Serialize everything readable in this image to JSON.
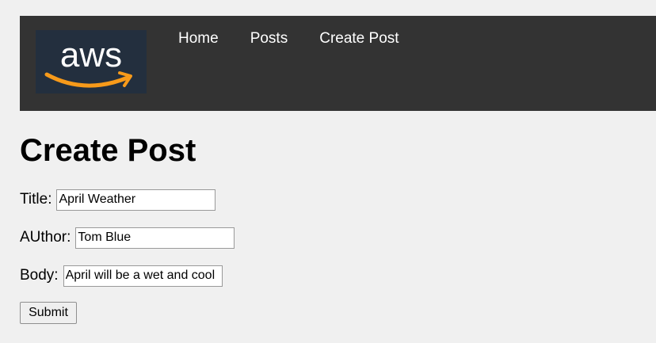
{
  "header": {
    "logo_text": "aws",
    "nav": [
      {
        "label": "Home"
      },
      {
        "label": "Posts"
      },
      {
        "label": "Create Post"
      }
    ],
    "colors": {
      "bar": "#333333",
      "logo_bg": "#232f3e",
      "logo_smile": "#f79a1a"
    }
  },
  "page": {
    "title": "Create Post"
  },
  "form": {
    "title_label": "Title:",
    "title_value": "April Weather",
    "author_label": "AUthor:",
    "author_value": "Tom Blue",
    "body_label": "Body:",
    "body_value": "April will be a wet and cool",
    "submit_label": "Submit"
  }
}
